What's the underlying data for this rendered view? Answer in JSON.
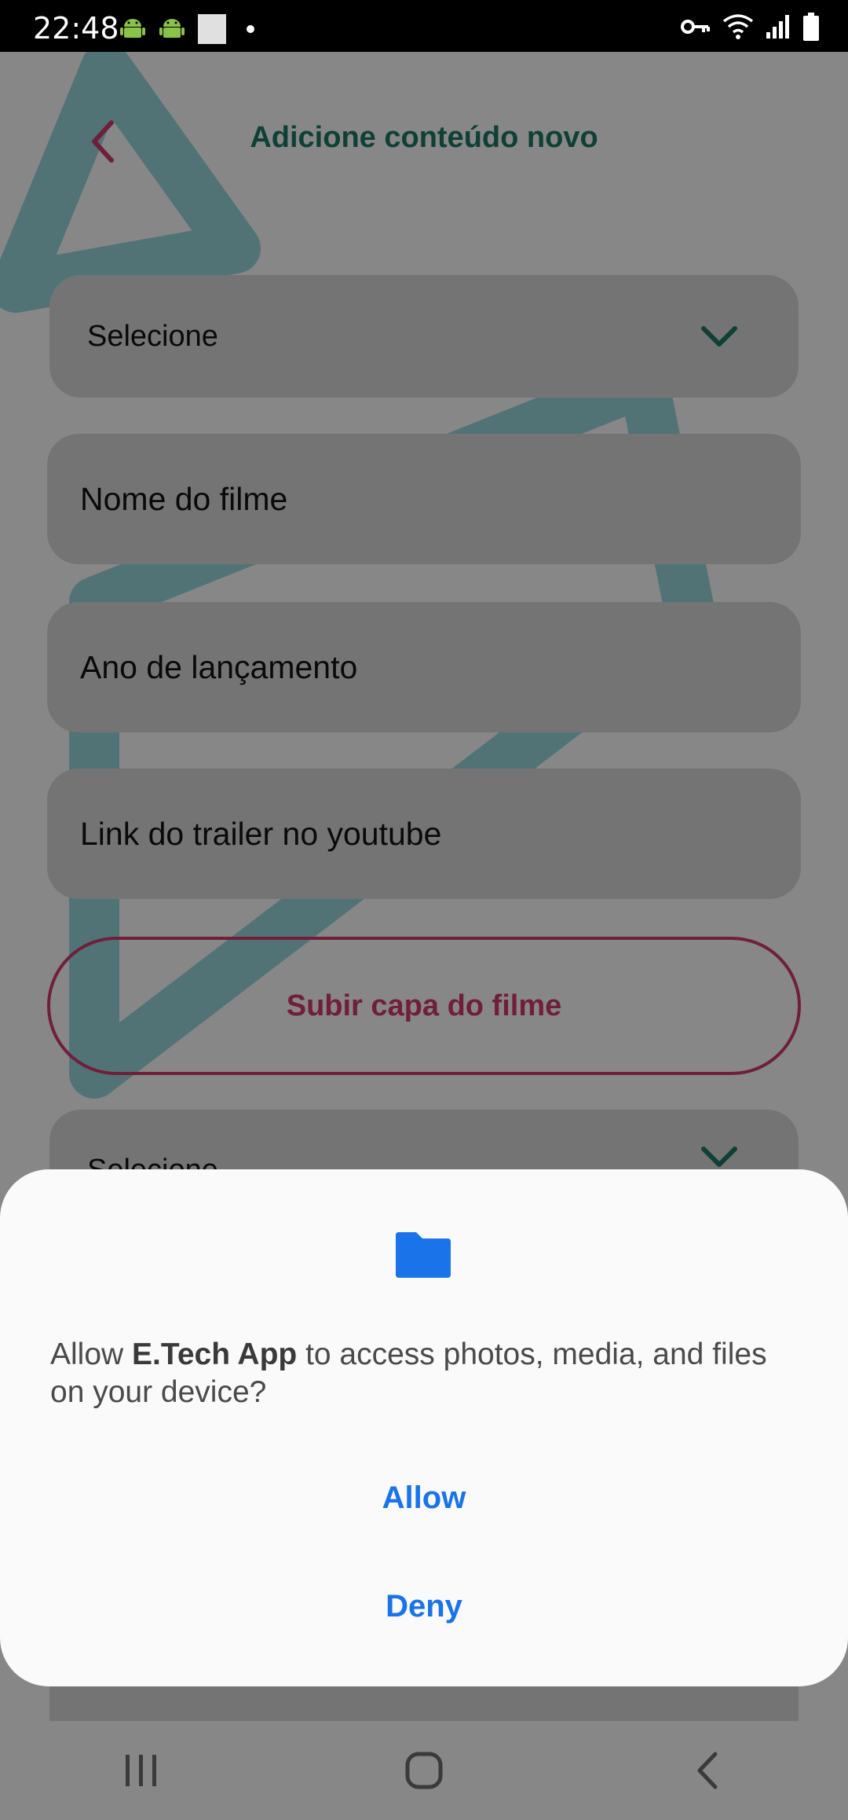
{
  "status_bar": {
    "time": "22:48"
  },
  "header": {
    "title": "Adicione conteúdo novo"
  },
  "form": {
    "category_select": {
      "value": "Selecione"
    },
    "movie_name": {
      "placeholder": "Nome do filme"
    },
    "release_year": {
      "placeholder": "Ano de lançamento"
    },
    "trailer_link": {
      "placeholder": "Link do trailer no youtube"
    },
    "upload_cover_label": "Subir capa do filme",
    "second_select": {
      "value": "Selecione"
    }
  },
  "dialog": {
    "message_prefix": "Allow ",
    "app_name": "E.Tech App",
    "message_suffix": " to access photos, media, and files on your device?",
    "allow_label": "Allow",
    "deny_label": "Deny"
  },
  "colors": {
    "accent_teal": "#1d7a66",
    "accent_pink": "#d43c6e",
    "dialog_button": "#1a73e8"
  }
}
